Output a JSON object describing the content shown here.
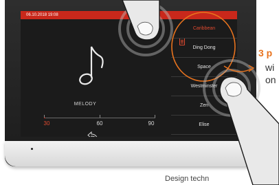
{
  "status_bar": {
    "datetime": "06.10.2018  19:08"
  },
  "player": {
    "label": "MELODY",
    "volume_levels": [
      "30",
      "60",
      "90"
    ],
    "selected_volume": "30"
  },
  "melody_menu": {
    "items": [
      "Caribbean",
      "Ding Dong",
      "Space",
      "Westminster",
      "Zen",
      "Elise"
    ],
    "selected": "Caribbean"
  },
  "callout": {
    "title": "3 p",
    "line1": "wi",
    "line2": "on"
  },
  "caption": "Design techn",
  "icons": [
    "music-note-icon",
    "back-arrow-icon",
    "document-icon",
    "finger-tap-icon"
  ],
  "colors": {
    "accent": "#c9281b",
    "callout": "#e8731e"
  }
}
